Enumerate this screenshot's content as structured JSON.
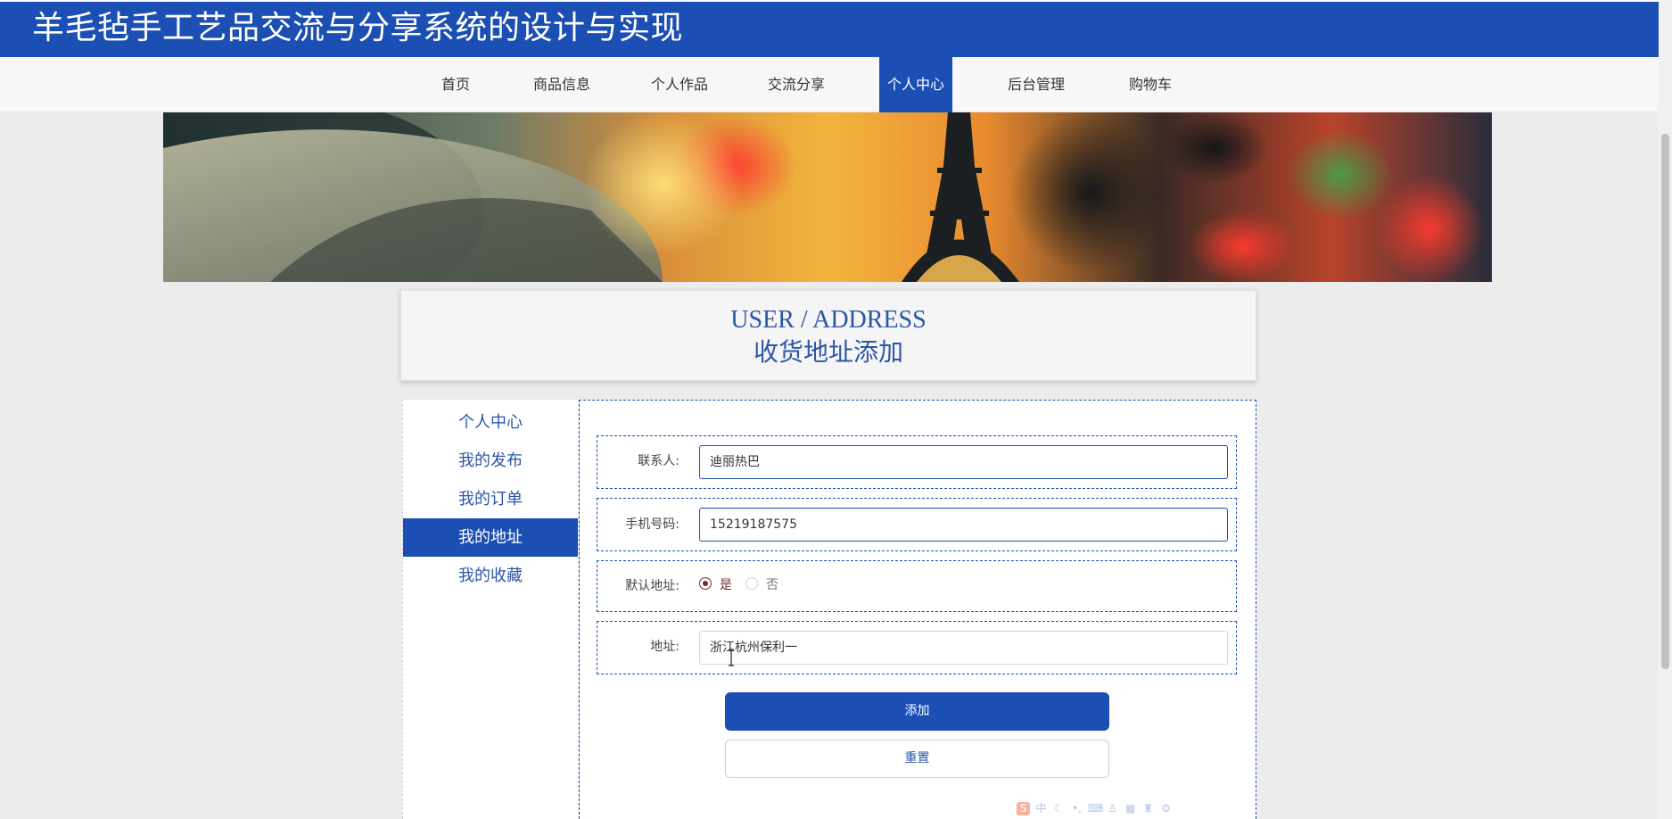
{
  "header": {
    "title": "羊毛毡手工艺品交流与分享系统的设计与实现"
  },
  "nav": {
    "items": [
      {
        "label": "首页"
      },
      {
        "label": "商品信息"
      },
      {
        "label": "个人作品"
      },
      {
        "label": "交流分享"
      },
      {
        "label": "个人中心"
      },
      {
        "label": "后台管理"
      },
      {
        "label": "购物车"
      }
    ],
    "active": "个人中心"
  },
  "page_heading": {
    "en": "USER / ADDRESS",
    "cn": "收货地址添加"
  },
  "sidebar": {
    "items": [
      {
        "label": "个人中心"
      },
      {
        "label": "我的发布"
      },
      {
        "label": "我的订单"
      },
      {
        "label": "我的地址"
      },
      {
        "label": "我的收藏"
      }
    ],
    "active": "我的地址"
  },
  "form": {
    "contact": {
      "label": "联系人:",
      "value": "迪丽热巴"
    },
    "phone": {
      "label": "手机号码:",
      "value": "15219187575"
    },
    "default_address": {
      "label": "默认地址:",
      "options": [
        "是",
        "否"
      ],
      "selected": "是"
    },
    "address": {
      "label": "地址:",
      "value": "浙江杭州保利一"
    },
    "submit_label": "添加",
    "reset_label": "重置"
  },
  "ime_toolbar": {
    "icons": [
      "ime-logo-icon",
      "chinese-mode-icon",
      "moon-icon",
      "punctuation-icon",
      "keyboard-icon",
      "user-icon",
      "grid-icon",
      "shirt-icon",
      "gear-icon"
    ],
    "glyphs": [
      "S",
      "中",
      "☾",
      "•,",
      "⌨",
      "♙",
      "▦",
      "♜",
      "⚙"
    ]
  },
  "colors": {
    "primary": "#1b4fb4",
    "heading_text": "#2c55a8",
    "radio_checked": "#7a2b2b"
  }
}
